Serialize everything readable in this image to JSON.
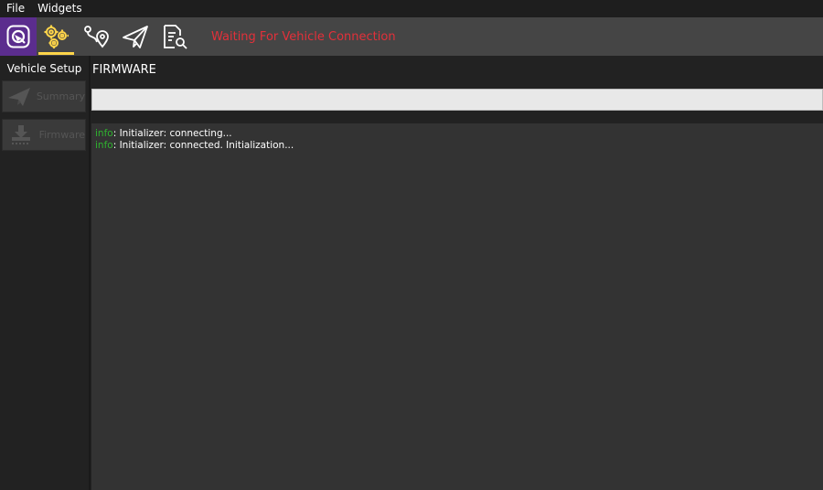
{
  "menubar": {
    "items": [
      "File",
      "Widgets"
    ]
  },
  "toolbar": {
    "buttons": [
      {
        "name": "vehicle-setup",
        "icon": "gears-icon",
        "active": true
      },
      {
        "name": "plan",
        "icon": "route-pin-icon",
        "active": false
      },
      {
        "name": "fly",
        "icon": "paper-plane-icon",
        "active": false
      },
      {
        "name": "analyze",
        "icon": "document-search-icon",
        "active": false
      }
    ],
    "status": "Waiting For Vehicle Connection",
    "status_color": "#e3303a",
    "accent_color": "#ffd54a",
    "logo_bg": "#5b2d8e"
  },
  "sidebar": {
    "title": "Vehicle Setup",
    "items": [
      {
        "label": "Summary",
        "icon": "paper-plane-icon"
      },
      {
        "label": "Firmware",
        "icon": "download-icon"
      }
    ]
  },
  "main": {
    "title": "FIRMWARE",
    "progress": 0,
    "log": [
      {
        "level": "info",
        "message": ": Initializer: connecting..."
      },
      {
        "level": "info",
        "message": ": Initializer: connected. Initialization..."
      }
    ]
  }
}
